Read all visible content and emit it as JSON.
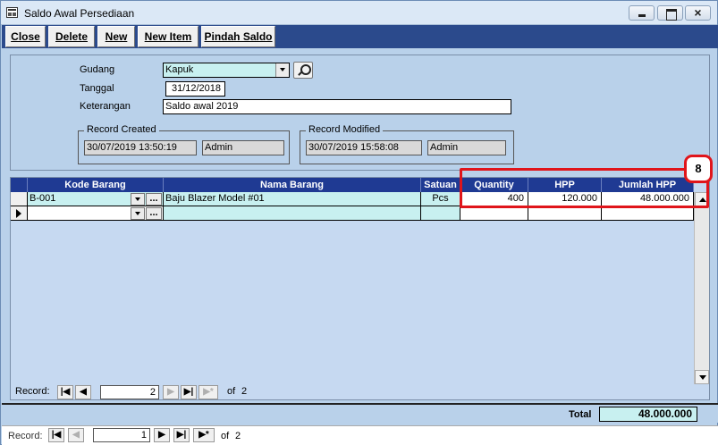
{
  "window": {
    "title": "Saldo Awal Persediaan"
  },
  "toolbar": {
    "close": "Close",
    "delete": "Delete",
    "new": "New",
    "new_item": "New Item",
    "pindah_saldo": "Pindah Saldo"
  },
  "form": {
    "gudang_label": "Gudang",
    "gudang_value": "Kapuk",
    "tanggal_label": "Tanggal",
    "tanggal_value": "31/12/2018",
    "keterangan_label": "Keterangan",
    "keterangan_value": "Saldo awal 2019",
    "record_created": {
      "title": "Record Created",
      "datetime": "30/07/2019 13:50:19",
      "user": "Admin"
    },
    "record_modified": {
      "title": "Record Modified",
      "datetime": "30/07/2019 15:58:08",
      "user": "Admin"
    }
  },
  "grid": {
    "columns": [
      "Kode Barang",
      "Nama Barang",
      "Satuan",
      "Quantity",
      "HPP",
      "Jumlah HPP"
    ],
    "rows": [
      {
        "kode": "B-001",
        "nama": "Baju Blazer Model #01",
        "satuan": "Pcs",
        "quantity": "400",
        "hpp": "120.000",
        "jumlah": "48.000.000"
      }
    ],
    "ellipsis": "...",
    "nav": {
      "label": "Record:",
      "current": "2",
      "of": "of",
      "total": "2"
    }
  },
  "annotation": {
    "number": "8"
  },
  "footer": {
    "total_label": "Total",
    "total_value": "48.000.000"
  },
  "record_nav": {
    "label": "Record:",
    "current": "1",
    "of": "of",
    "total": "2"
  },
  "colors": {
    "header_blue": "#1f3a93",
    "toolbar_blue": "#2b4a8c",
    "cell_cyan": "#c8f0f0",
    "highlight_red": "#e0151b"
  }
}
